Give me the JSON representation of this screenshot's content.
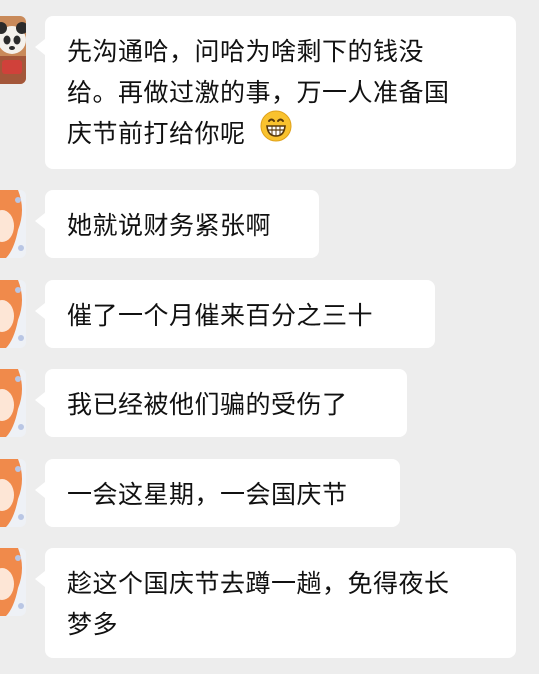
{
  "messages": [
    {
      "sender": "contact-panda",
      "lines": [
        "先沟通哈，问哈为啥剩下的钱没",
        "给。再做过激的事，万一人准备国",
        "庆节前打给你呢"
      ],
      "emoji": "grin-emoji"
    },
    {
      "sender": "contact-redhair",
      "lines": [
        "她就说财务紧张啊"
      ]
    },
    {
      "sender": "contact-redhair",
      "lines": [
        "催了一个月催来百分之三十"
      ]
    },
    {
      "sender": "contact-redhair",
      "lines": [
        "我已经被他们骗的受伤了"
      ]
    },
    {
      "sender": "contact-redhair",
      "lines": [
        "一会这星期，一会国庆节"
      ]
    },
    {
      "sender": "contact-redhair",
      "lines": [
        "趁这个国庆节去蹲一趟，免得夜长",
        "梦多"
      ]
    }
  ]
}
